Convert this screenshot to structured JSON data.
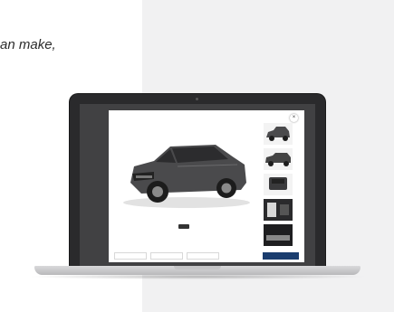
{
  "tagline": "an make,",
  "modal": {
    "close_label": "×",
    "photo_counter": "",
    "form_title": "",
    "form_subtitle": "",
    "inputs": [
      {
        "placeholder": ""
      },
      {
        "placeholder": ""
      },
      {
        "placeholder": ""
      }
    ],
    "submit_label": ""
  },
  "colors": {
    "submit_button": "#1b3d6e",
    "vehicle_body": "#4a4a4c",
    "panel_background": "#f1f1f2"
  }
}
